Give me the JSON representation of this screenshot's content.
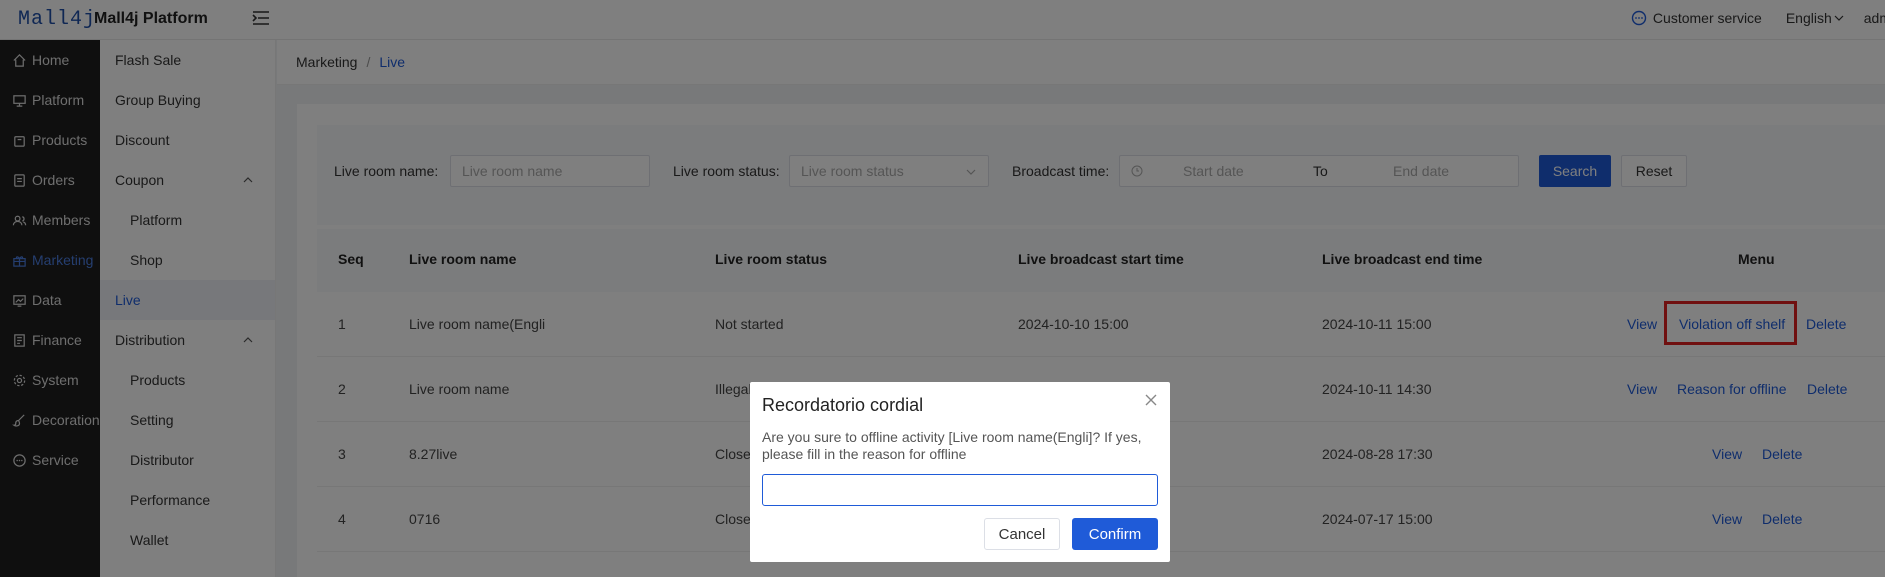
{
  "header": {
    "logo": "Mall4j",
    "title": "Mall4j Platform",
    "customer_service": "Customer service",
    "language": "English",
    "user": "adm"
  },
  "sidebar": {
    "items": [
      {
        "label": "Home",
        "icon": "home-icon"
      },
      {
        "label": "Platform",
        "icon": "monitor-icon"
      },
      {
        "label": "Products",
        "icon": "bag-icon"
      },
      {
        "label": "Orders",
        "icon": "list-icon"
      },
      {
        "label": "Members",
        "icon": "users-icon"
      },
      {
        "label": "Marketing",
        "icon": "gift-icon",
        "active": true
      },
      {
        "label": "Data",
        "icon": "chart-icon"
      },
      {
        "label": "Finance",
        "icon": "document-icon"
      },
      {
        "label": "System",
        "icon": "gear-icon"
      },
      {
        "label": "Decoration",
        "icon": "brush-icon"
      },
      {
        "label": "Service",
        "icon": "chat-icon"
      }
    ]
  },
  "subsidebar": {
    "items": [
      {
        "label": "Flash Sale"
      },
      {
        "label": "Group Buying"
      },
      {
        "label": "Discount"
      },
      {
        "label": "Coupon"
      },
      {
        "label": "Platform"
      },
      {
        "label": "Shop"
      },
      {
        "label": "Live"
      },
      {
        "label": "Distribution"
      },
      {
        "label": "Products"
      },
      {
        "label": "Setting"
      },
      {
        "label": "Distributor"
      },
      {
        "label": "Performance"
      },
      {
        "label": "Wallet"
      }
    ]
  },
  "breadcrumb": {
    "parent": "Marketing",
    "separator": "/",
    "current": "Live"
  },
  "filters": {
    "room_name_label": "Live room name:",
    "room_name_placeholder": "Live room name",
    "status_label": "Live room status:",
    "status_placeholder": "Live room status",
    "time_label": "Broadcast time:",
    "start_placeholder": "Start date",
    "to_label": "To",
    "end_placeholder": "End date",
    "search_button": "Search",
    "reset_button": "Reset"
  },
  "table": {
    "columns": [
      "Seq",
      "Live room name",
      "Live room status",
      "Live broadcast start time",
      "Live broadcast end time",
      "Menu"
    ],
    "rows": [
      {
        "seq": "1",
        "name": "Live room name(Engli",
        "status": "Not started",
        "start": "2024-10-10 15:00",
        "end": "2024-10-11 15:00",
        "actions": [
          "View",
          "Violation off shelf",
          "Delete"
        ]
      },
      {
        "seq": "2",
        "name": "Live room name",
        "status": "Illegal",
        "start": "",
        "end": "2024-10-11 14:30",
        "actions": [
          "View",
          "Reason for offline",
          "Delete"
        ]
      },
      {
        "seq": "3",
        "name": "8.27live",
        "status": "Close",
        "start": "",
        "end": "2024-08-28 17:30",
        "actions": [
          "View",
          "Delete"
        ]
      },
      {
        "seq": "4",
        "name": "0716",
        "status": "Close",
        "start": "",
        "end": "2024-07-17 15:00",
        "actions": [
          "View",
          "Delete"
        ]
      }
    ]
  },
  "dialog": {
    "title": "Recordatorio cordial",
    "message": "Are you sure to offline activity [Live room name(Engli]? If yes, please fill in the reason for offline",
    "input_value": "",
    "cancel": "Cancel",
    "confirm": "Confirm"
  },
  "colors": {
    "accent": "#1f5bd8",
    "sidebar_bg": "#1f1f1f",
    "highlight": "#e02020"
  }
}
